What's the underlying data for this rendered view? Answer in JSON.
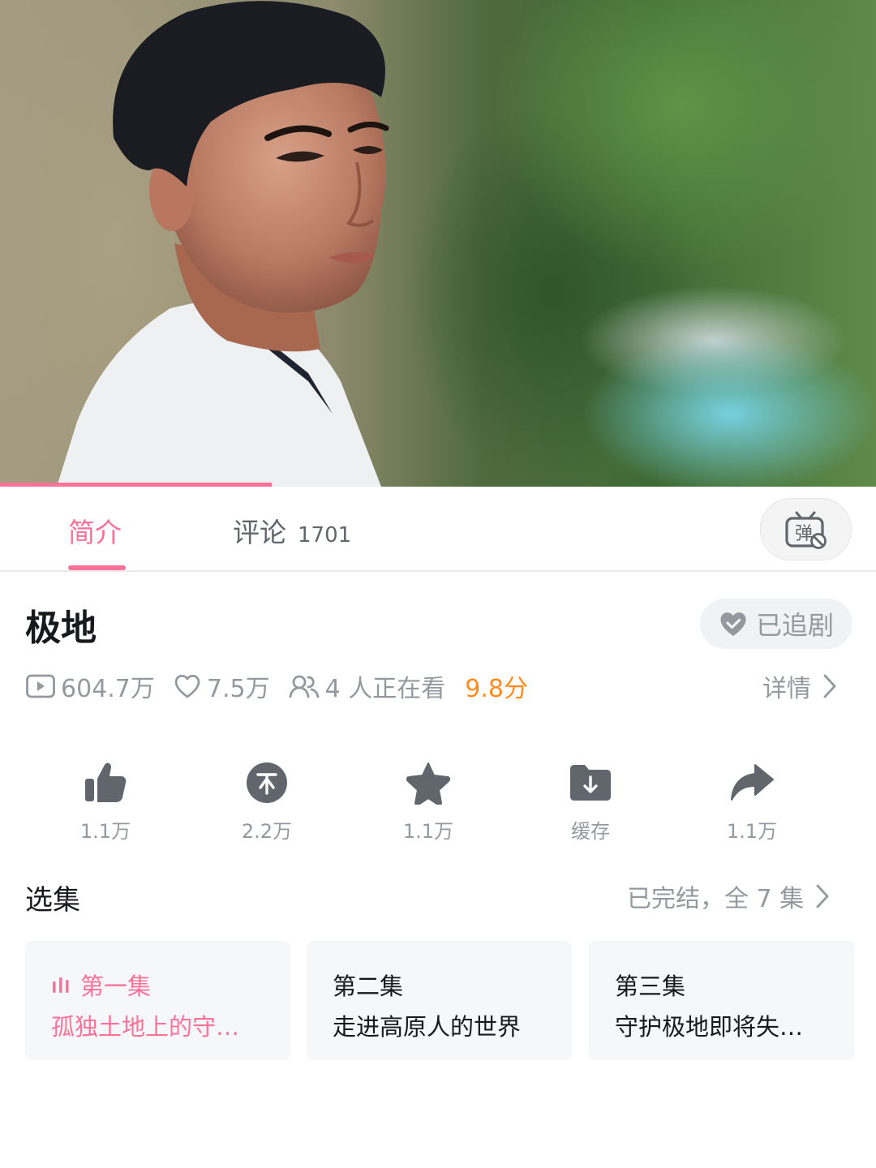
{
  "player": {
    "progress": 0.31
  },
  "tabs": [
    {
      "label": "简介",
      "active": true
    },
    {
      "label": "评论",
      "count": "1701",
      "active": false
    }
  ],
  "danmaku_toggle": {
    "icon": "danmaku-off-icon",
    "label": "弹"
  },
  "video": {
    "title": "极地",
    "follow_label": "已追剧",
    "stats": {
      "plays": "604.7万",
      "favorites": "7.5万",
      "watching": "4 人正在看",
      "rating": "9.8分"
    },
    "details_label": "详情"
  },
  "actions": [
    {
      "icon": "thumbs-up-icon",
      "label": "1.1万"
    },
    {
      "icon": "coin-icon",
      "label": "2.2万"
    },
    {
      "icon": "star-icon",
      "label": "1.1万"
    },
    {
      "icon": "download-folder-icon",
      "label": "缓存"
    },
    {
      "icon": "share-icon",
      "label": "1.1万"
    }
  ],
  "episodes": {
    "section_title": "选集",
    "status": "已完结，全 7 集",
    "items": [
      {
        "name": "第一集",
        "subtitle": "孤独土地上的守…",
        "active": true
      },
      {
        "name": "第二集",
        "subtitle": "走进高原人的世界",
        "active": false
      },
      {
        "name": "第三集",
        "subtitle": "守护极地即将失…",
        "active": false
      }
    ]
  },
  "colors": {
    "accent": "#fb7299",
    "rating": "#ff8a1e",
    "muted_text": "#9499a0",
    "primary_text": "#18191c"
  }
}
